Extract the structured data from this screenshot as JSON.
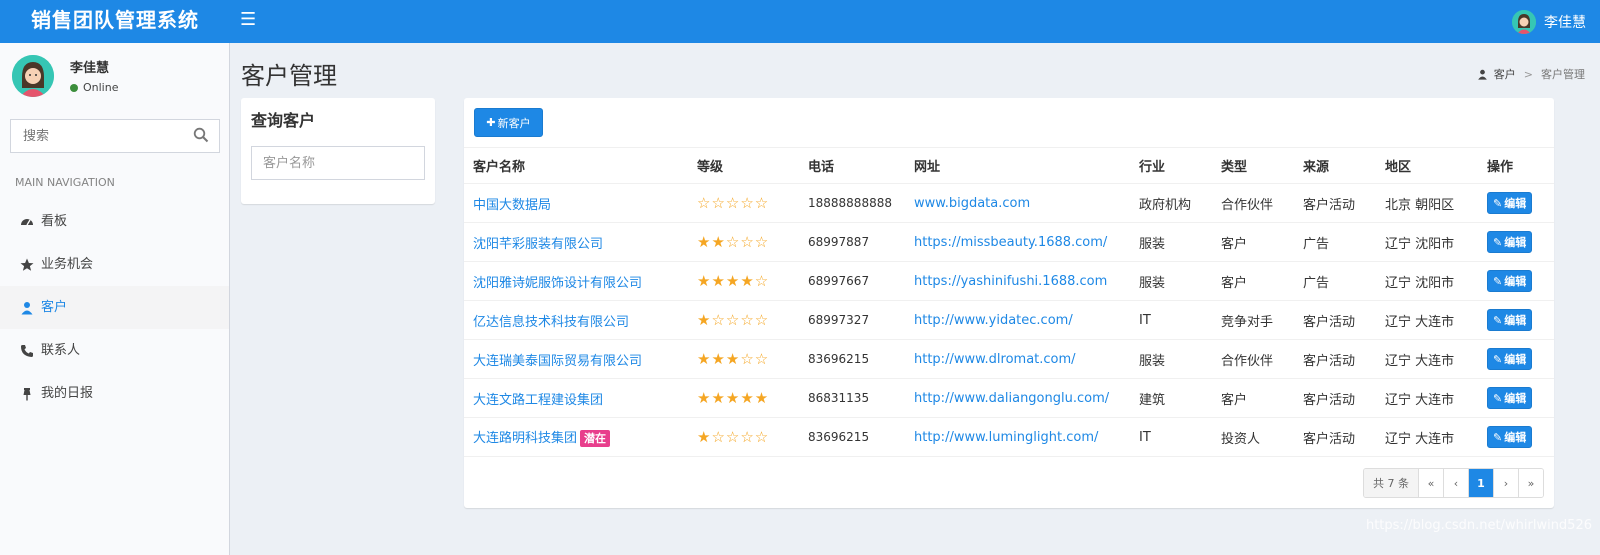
{
  "app": {
    "title": "销售团队管理系统"
  },
  "header": {
    "user_name": "李佳慧",
    "menu_icon": "menu-icon"
  },
  "sidebar": {
    "user_name": "李佳慧",
    "status": "Online",
    "search_placeholder": "搜索",
    "nav_header": "MAIN NAVIGATION",
    "items": [
      {
        "label": "看板",
        "icon": "dashboard-icon"
      },
      {
        "label": "业务机会",
        "icon": "star-icon"
      },
      {
        "label": "客户",
        "icon": "user-icon",
        "active": true
      },
      {
        "label": "联系人",
        "icon": "phone-icon"
      },
      {
        "label": "我的日报",
        "icon": "pin-icon"
      }
    ]
  },
  "page": {
    "title": "客户管理",
    "breadcrumb": {
      "parent": "客户",
      "current": "客户管理"
    }
  },
  "query": {
    "title": "查询客户",
    "placeholder": "客户名称"
  },
  "table": {
    "new_button": "新客户",
    "columns": [
      "客户名称",
      "等级",
      "电话",
      "网址",
      "行业",
      "类型",
      "来源",
      "地区",
      "操作"
    ],
    "edit_label": "编辑",
    "rows": [
      {
        "name": "中国大数据局",
        "tag": "",
        "stars": "☆☆☆☆☆",
        "rating": 0,
        "phone": "18888888888",
        "url": "www.bigdata.com",
        "industry": "政府机构",
        "type": "合作伙伴",
        "source": "客户活动",
        "region": "北京 朝阳区"
      },
      {
        "name": "沈阳芊彩服装有限公司",
        "tag": "",
        "stars": "★★☆☆☆",
        "rating": 2,
        "phone": "68997887",
        "url": "https://missbeauty.1688.com/",
        "industry": "服装",
        "type": "客户",
        "source": "广告",
        "region": "辽宁 沈阳市"
      },
      {
        "name": "沈阳雅诗妮服饰设计有限公司",
        "tag": "",
        "stars": "★★★★☆",
        "rating": 4,
        "phone": "68997667",
        "url": "https://yashinifushi.1688.com",
        "industry": "服装",
        "type": "客户",
        "source": "广告",
        "region": "辽宁 沈阳市"
      },
      {
        "name": "亿达信息技术科技有限公司",
        "tag": "",
        "stars": "★☆☆☆☆",
        "rating": 1,
        "phone": "68997327",
        "url": "http://www.yidatec.com/",
        "industry": "IT",
        "type": "竞争对手",
        "source": "客户活动",
        "region": "辽宁 大连市"
      },
      {
        "name": "大连瑞美泰国际贸易有限公司",
        "tag": "",
        "stars": "★★★☆☆",
        "rating": 3,
        "phone": "83696215",
        "url": "http://www.dlromat.com/",
        "industry": "服装",
        "type": "合作伙伴",
        "source": "客户活动",
        "region": "辽宁 大连市"
      },
      {
        "name": "大连文路工程建设集团",
        "tag": "",
        "stars": "★★★★★",
        "rating": 5,
        "phone": "86831135",
        "url": "http://www.daliangonglu.com/",
        "industry": "建筑",
        "type": "客户",
        "source": "客户活动",
        "region": "辽宁 大连市"
      },
      {
        "name": "大连路明科技集团",
        "tag": "潜在",
        "stars": "★☆☆☆☆",
        "rating": 1,
        "phone": "83696215",
        "url": "http://www.luminglight.com/",
        "industry": "IT",
        "type": "投资人",
        "source": "客户活动",
        "region": "辽宁 大连市"
      }
    ]
  },
  "pagination": {
    "total": "共 7 条",
    "first": "«",
    "prev": "‹",
    "current": "1",
    "next": "›",
    "last": "»"
  },
  "watermark": "https://blog.csdn.net/whirlwind526",
  "colors": {
    "primary": "#1e88e5",
    "star": "#f5a623",
    "tag": "#e83e8c",
    "online": "#3c8e3c"
  }
}
